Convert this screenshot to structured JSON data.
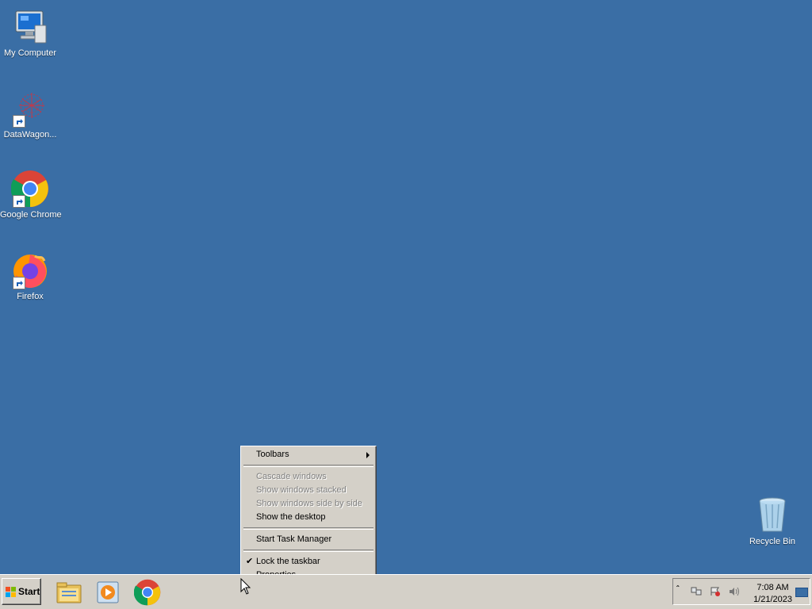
{
  "desktop": {
    "icons": [
      {
        "label": "My Computer",
        "icon": "computer-icon"
      },
      {
        "label": "DataWagon...",
        "icon": "datawagon-icon"
      },
      {
        "label": "Google Chrome",
        "icon": "chrome-icon"
      },
      {
        "label": "Firefox",
        "icon": "firefox-icon"
      },
      {
        "label": "Recycle Bin",
        "icon": "recycle-bin-icon"
      }
    ]
  },
  "context_menu": {
    "items": [
      {
        "label": "Toolbars",
        "enabled": true,
        "submenu": true
      },
      {
        "label": "Cascade windows",
        "enabled": false
      },
      {
        "label": "Show windows stacked",
        "enabled": false
      },
      {
        "label": "Show windows side by side",
        "enabled": false
      },
      {
        "label": "Show the desktop",
        "enabled": true
      },
      {
        "label": "Start Task Manager",
        "enabled": true
      },
      {
        "label": "Lock the taskbar",
        "enabled": true,
        "checked": true
      },
      {
        "label": "Properties",
        "enabled": true
      }
    ]
  },
  "taskbar": {
    "start_label": "Start",
    "pinned": [
      {
        "icon": "file-explorer-icon"
      },
      {
        "icon": "media-player-icon"
      },
      {
        "icon": "chrome-icon"
      }
    ],
    "tray": {
      "icons": [
        "show-hidden-icons-icon",
        "network-icon",
        "action-center-icon",
        "volume-icon"
      ],
      "time": "7:08 AM",
      "date": "1/21/2023"
    }
  },
  "colors": {
    "desktop_background": "#3a6ea5",
    "taskbar_background": "#d4d0c8",
    "disabled_text": "#808080"
  }
}
